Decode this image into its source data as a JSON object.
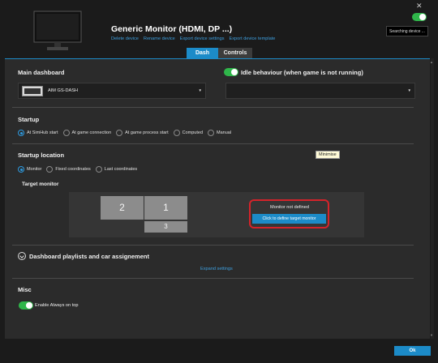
{
  "header": {
    "title": "Generic Monitor (HDMI, DP ...)",
    "links": [
      "Delete device",
      "Rename device",
      "Export device settings",
      "Export device template"
    ],
    "close": "✕",
    "search_status": "Searching device ..."
  },
  "tabs": [
    {
      "label": "Dash",
      "active": true
    },
    {
      "label": "Controls",
      "active": false
    }
  ],
  "main_dashboard": {
    "title": "Main dashboard",
    "selected": "AIM GS-DASH",
    "idle_label": "Idle behaviour (when game is not running)",
    "idle_selected": ""
  },
  "startup": {
    "title": "Startup",
    "options": [
      "At SimHub start",
      "At game connection",
      "At game process start",
      "Computed",
      "Manual"
    ],
    "selected_index": 0
  },
  "startup_location": {
    "title": "Startup location",
    "options": [
      "Monitor",
      "Fixed coordinates",
      "Last coordinates"
    ],
    "selected_index": 0,
    "tooltip": "Minimise"
  },
  "target_monitor": {
    "title": "Target monitor",
    "monitors": [
      "2",
      "1",
      "3"
    ],
    "status": "Monitor not defined",
    "define_button": "Click to define target monitor"
  },
  "playlists": {
    "title": "Dashboard playlists and car assignement",
    "expand": "Expand settings"
  },
  "misc": {
    "title": "Misc",
    "always_on_top": "Enable Always on top"
  },
  "footer": {
    "ok": "Ok"
  },
  "colors": {
    "accent": "#1c8bc8",
    "toggle_on": "#2fb64a",
    "highlight": "#d5232a"
  }
}
